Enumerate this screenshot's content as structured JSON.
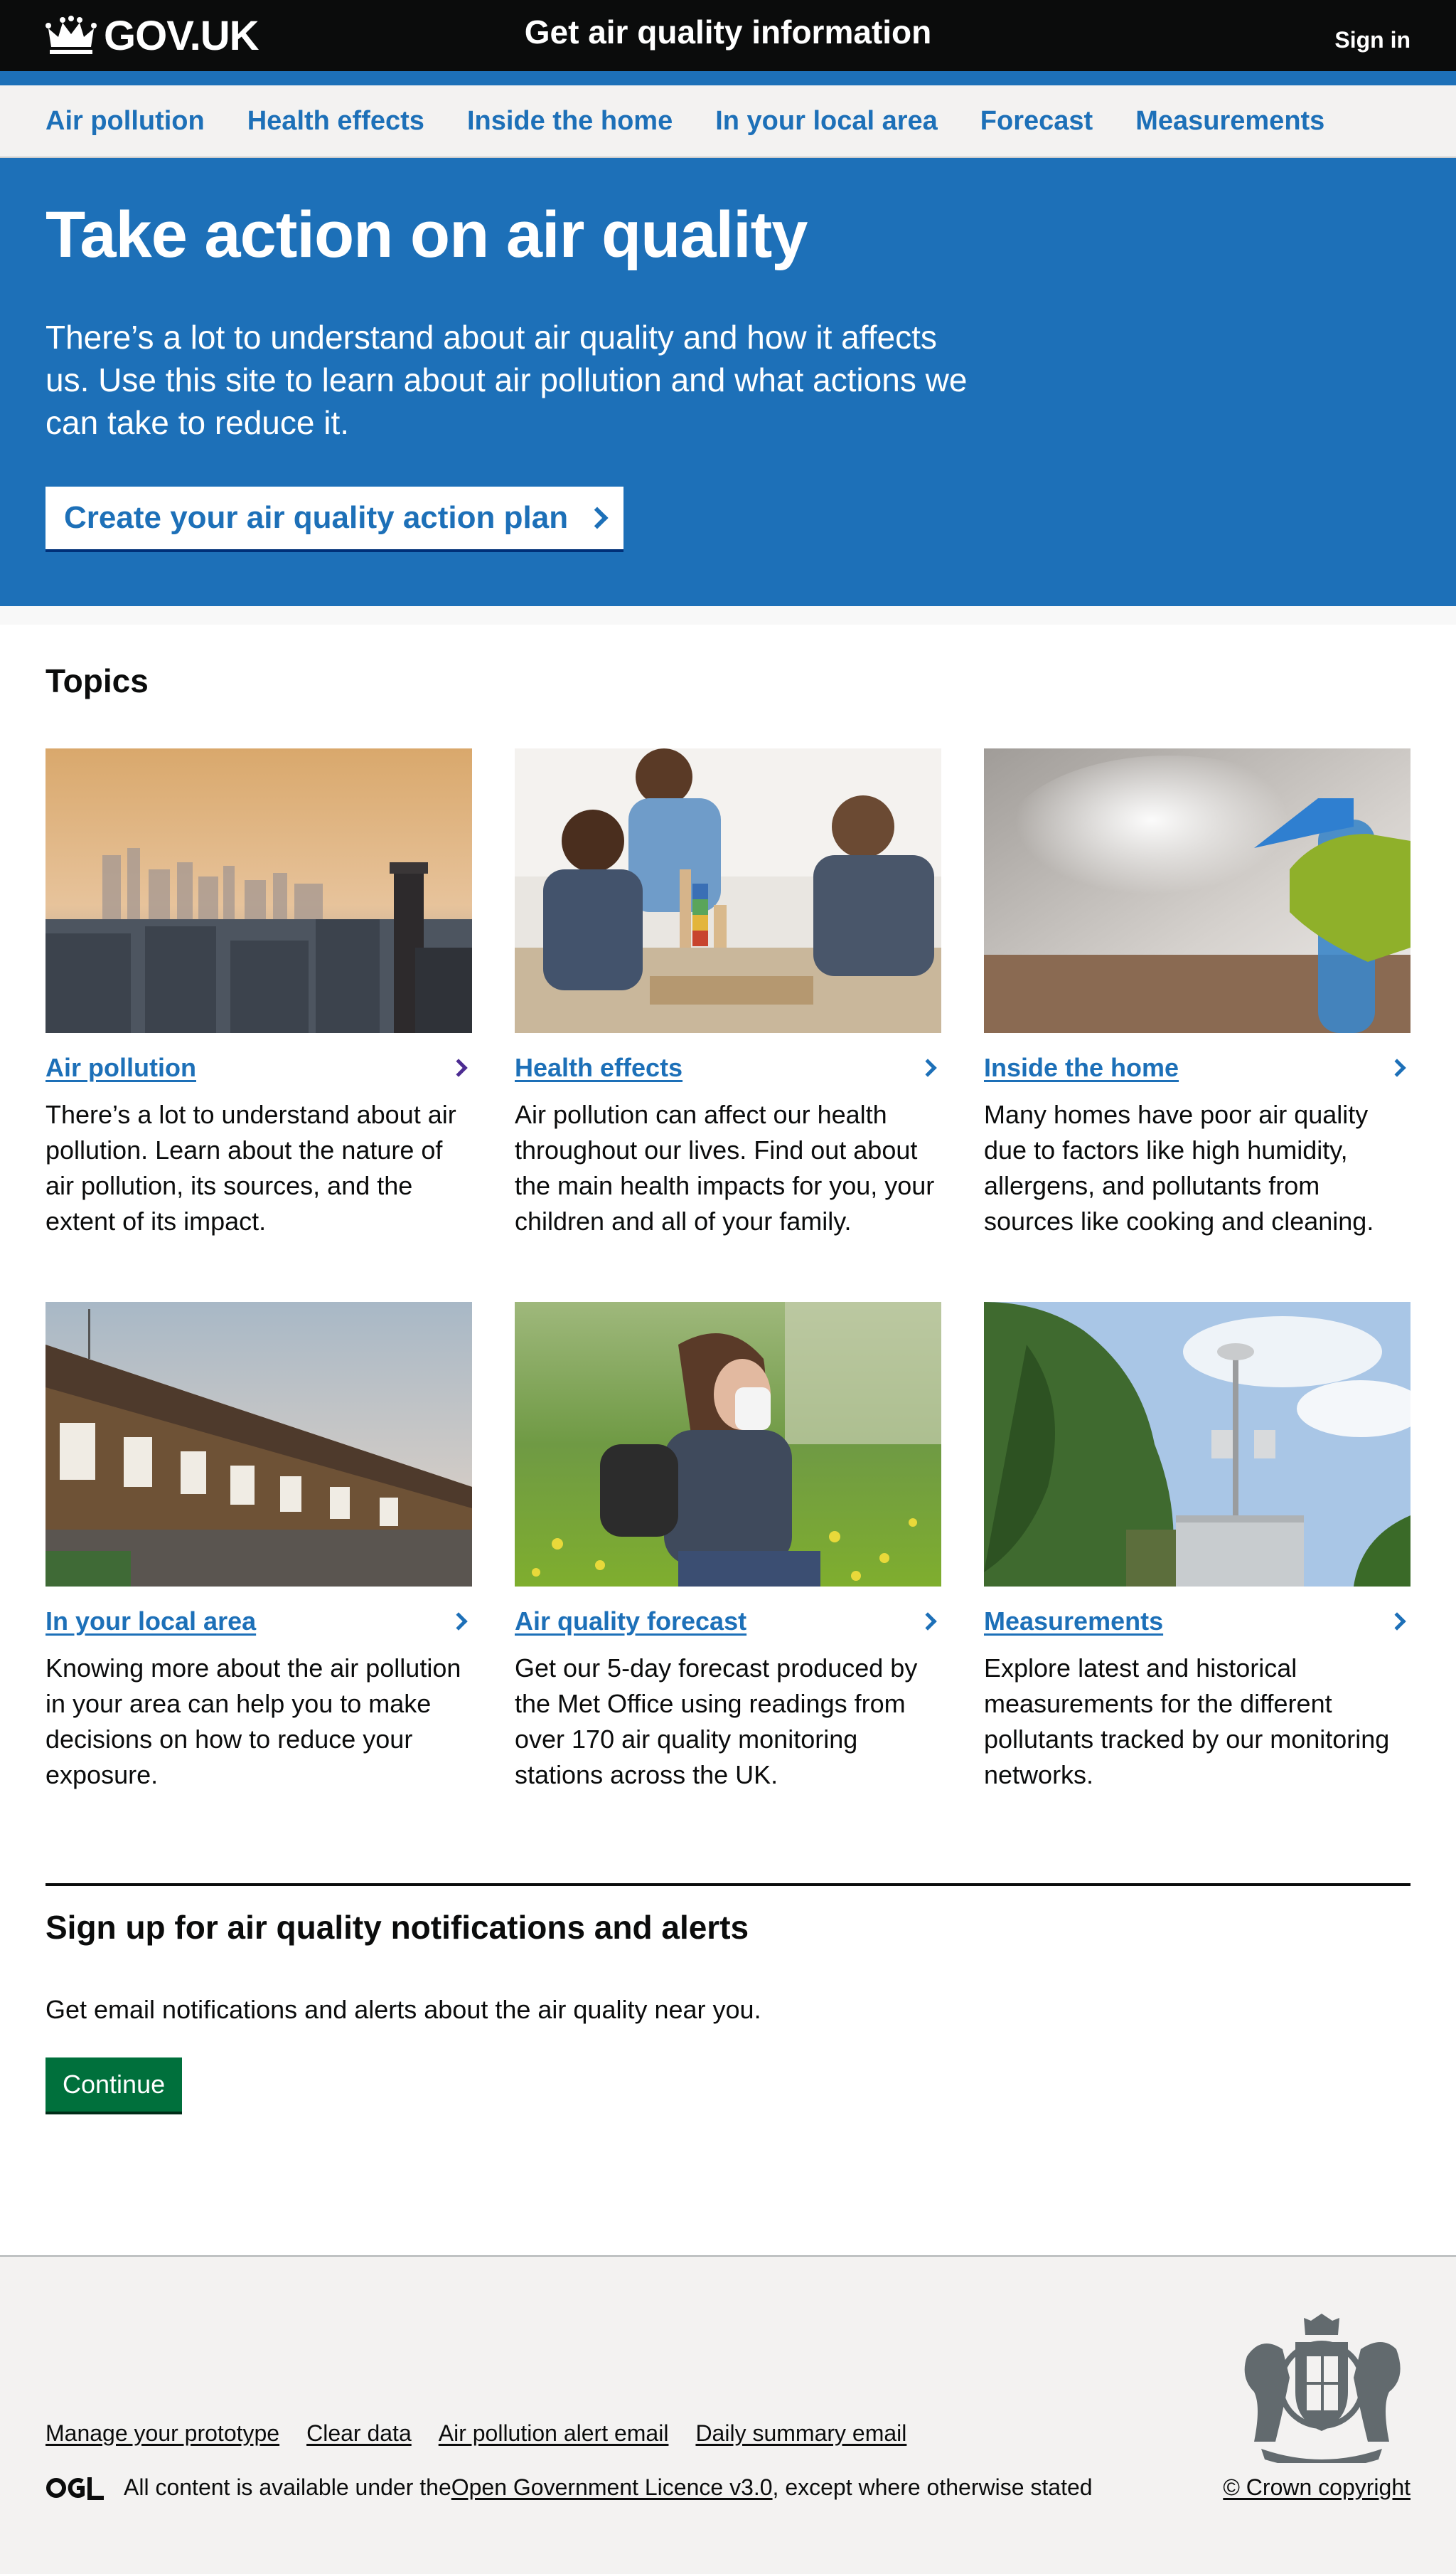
{
  "header": {
    "logo_text": "GOV.UK",
    "service_name": "Get air quality information",
    "sign_in": "Sign in"
  },
  "nav": {
    "items": [
      {
        "label": "Air pollution"
      },
      {
        "label": "Health effects"
      },
      {
        "label": "Inside the home"
      },
      {
        "label": "In your local area"
      },
      {
        "label": "Forecast"
      },
      {
        "label": "Measurements"
      }
    ]
  },
  "hero": {
    "title": "Take action on air quality",
    "lead": "There’s a lot to understand about air quality and how it affects us. Use this site to learn about air pollution and what actions we can take to reduce it.",
    "button": "Create your air quality action plan"
  },
  "topics": {
    "heading": "Topics",
    "cards": [
      {
        "title": "Air pollution",
        "text": "There’s a lot to understand about air pollution. Learn about the nature of air pollution, its sources, and the extent of its impact.",
        "image": "city-skyline-smog-photo"
      },
      {
        "title": "Health effects",
        "text": "Air pollution can affect our health throughout our lives. Find out about the main health impacts for you, your children and all of your family.",
        "image": "family-playing-photo"
      },
      {
        "title": "Inside the home",
        "text": "Many homes have poor air quality due to factors like high humidity, allergens, and pollutants from sources like cooking and cleaning.",
        "image": "cleaning-spray-photo"
      },
      {
        "title": "In your local area",
        "text": "Knowing more about the air pollution in your area can help you to make decisions on how to reduce your exposure.",
        "image": "terraced-houses-photo"
      },
      {
        "title": "Air quality forecast",
        "text": "Get our 5-day forecast produced by the Met Office using readings from over 170 air quality monitoring stations across the UK.",
        "image": "woman-sneezing-photo"
      },
      {
        "title": "Measurements",
        "text": "Explore latest and historical measurements for the different pollutants tracked by our monitoring networks.",
        "image": "monitoring-station-photo"
      }
    ]
  },
  "signup": {
    "heading": "Sign up for air quality notifications and alerts",
    "text": "Get email notifications and alerts about the air quality near you.",
    "button": "Continue"
  },
  "footer": {
    "links": [
      {
        "label": "Manage your prototype"
      },
      {
        "label": "Clear data"
      },
      {
        "label": "Air pollution alert email"
      },
      {
        "label": "Daily summary email"
      }
    ],
    "licence_prefix": "All content is available under the ",
    "licence_link": "Open Government Licence v3.0",
    "licence_suffix": ", except where otherwise stated",
    "copyright": "© Crown copyright"
  },
  "colors": {
    "header_bg": "#0b0c0c",
    "brand_blue": "#1d70b8",
    "nav_bg": "#f3f2f1",
    "button_green": "#00703c",
    "visited_purple": "#4c2c92"
  }
}
